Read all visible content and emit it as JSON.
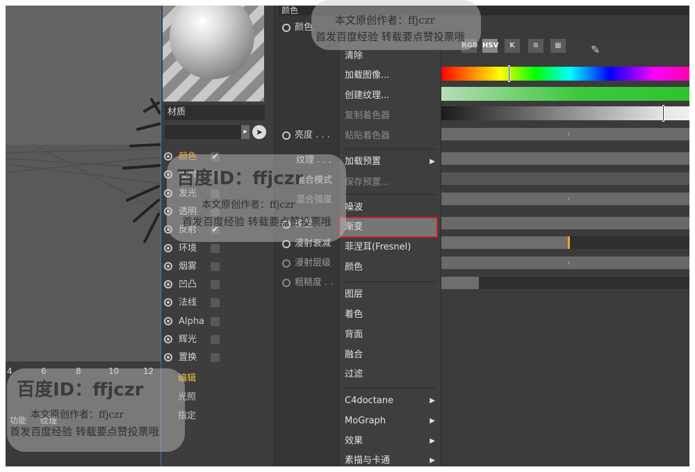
{
  "viewport": {
    "ruler_ticks": [
      "4",
      "6",
      "8",
      "10",
      "12"
    ],
    "bottom_tabs": [
      "功能",
      "纹理"
    ]
  },
  "material": {
    "name_label": "材质",
    "channels": [
      {
        "label": "颜色",
        "checked": true,
        "active": true
      },
      {
        "label": "漫射",
        "checked": false,
        "active": false
      },
      {
        "label": "发光",
        "checked": false,
        "active": false
      },
      {
        "label": "透明",
        "checked": false,
        "active": false
      },
      {
        "label": "反射",
        "checked": true,
        "active": false
      },
      {
        "label": "环境",
        "checked": false,
        "active": false
      },
      {
        "label": "烟雾",
        "checked": false,
        "active": false
      },
      {
        "label": "凹凸",
        "checked": false,
        "active": false
      },
      {
        "label": "法线",
        "checked": false,
        "active": false
      },
      {
        "label": "Alpha",
        "checked": false,
        "active": false
      },
      {
        "label": "辉光",
        "checked": false,
        "active": false
      },
      {
        "label": "置换",
        "checked": false,
        "active": false
      }
    ],
    "edit_label": "编辑",
    "light_label": "光照",
    "assign_label": "指定"
  },
  "attributes": {
    "header": "颜色",
    "color_label": "颜色",
    "brightness_label": "亮度 . . .",
    "texture_label": "纹理 . . .",
    "mix_mode_label": "混合模式",
    "mix_strength_label": "混合强度",
    "model_label": "模型",
    "diffuse_falloff_label": "漫射衰减",
    "diffuse_level_label": "漫射层级",
    "roughness_label": "粗糙度 . ."
  },
  "menu": {
    "items": [
      {
        "label": "清除",
        "disabled": false,
        "submenu": false
      },
      {
        "label": "加载图像...",
        "disabled": false,
        "submenu": false
      },
      {
        "label": "创建纹理...",
        "disabled": false,
        "submenu": false
      },
      {
        "label": "复制着色器",
        "disabled": true,
        "submenu": false
      },
      {
        "label": "粘贴着色器",
        "disabled": true,
        "submenu": false
      },
      {
        "label": "加载预置",
        "disabled": false,
        "submenu": true
      },
      {
        "label": "保存预置...",
        "disabled": true,
        "submenu": false
      },
      {
        "label": "噪波",
        "disabled": false,
        "submenu": false
      },
      {
        "label": "渐变",
        "disabled": false,
        "submenu": false,
        "highlighted": true
      },
      {
        "label": "菲涅耳(Fresnel)",
        "disabled": false,
        "submenu": false
      },
      {
        "label": "颜色",
        "disabled": false,
        "submenu": false
      },
      {
        "label": "图层",
        "disabled": false,
        "submenu": false
      },
      {
        "label": "着色",
        "disabled": false,
        "submenu": false
      },
      {
        "label": "背面",
        "disabled": false,
        "submenu": false
      },
      {
        "label": "融合",
        "disabled": false,
        "submenu": false
      },
      {
        "label": "过滤",
        "disabled": false,
        "submenu": false
      },
      {
        "label": "C4doctane",
        "disabled": false,
        "submenu": true
      },
      {
        "label": "MoGraph",
        "disabled": false,
        "submenu": true
      },
      {
        "label": "效果",
        "disabled": false,
        "submenu": true
      },
      {
        "label": "素描与卡通",
        "disabled": false,
        "submenu": true
      }
    ],
    "submenu_arrow": "▶"
  },
  "color_panel": {
    "toolbar_buttons": [
      "RGB",
      "HSV",
      "K",
      "≡",
      "▦"
    ],
    "active_button": "HSV",
    "hue_position": 0.27,
    "value_position": 0.89,
    "accent": "#f5a623"
  },
  "watermark": {
    "id_line": "百度ID：ffjczr",
    "author_line": "本文原创作者：ffjczr",
    "notice_line": "首发百度经验 转载要点赞投票哦"
  },
  "colors": {
    "active_channel": "#f5a623",
    "highlight_border": "#d02020",
    "viewport_divider": "#4a78a8"
  }
}
